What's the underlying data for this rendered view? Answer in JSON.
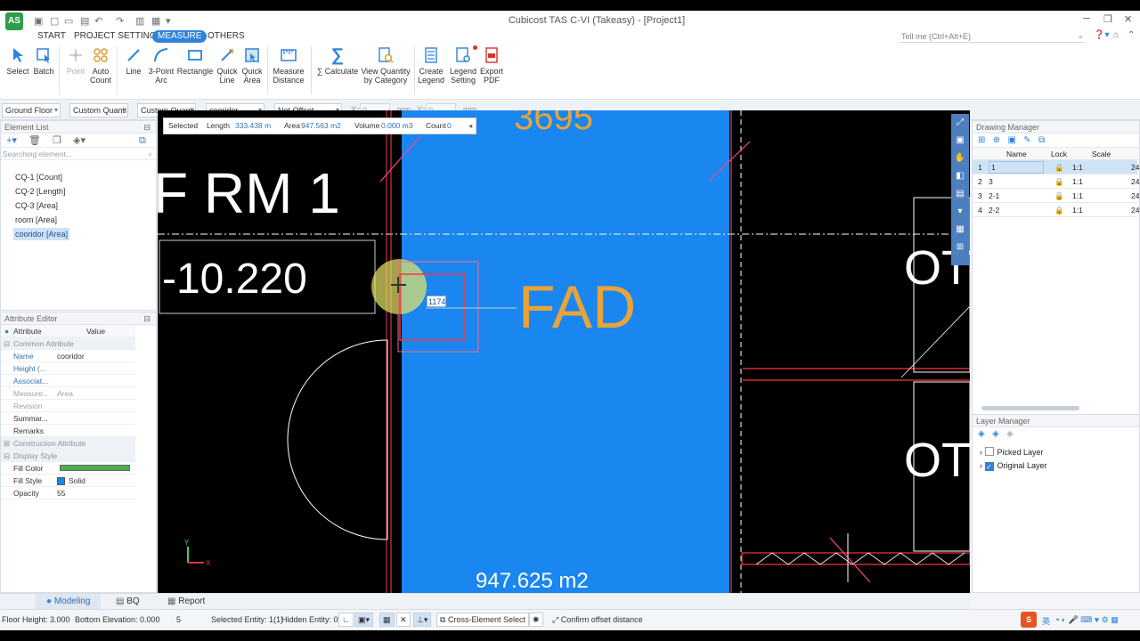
{
  "app": {
    "title": "Cubicost TAS C-VI (Takeasy) - [Project1]",
    "logo_text": "AS"
  },
  "tabs": [
    "START",
    "PROJECT SETTINGS",
    "MEASURE",
    "OTHERS"
  ],
  "active_tab": "MEASURE",
  "tell_me": "Tell me (Ctrl+Alt+E)",
  "ribbon": {
    "select": "Select",
    "batch": "Batch",
    "point": "Point",
    "auto_count_1": "Auto",
    "auto_count_2": "Count",
    "line": "Line",
    "arc_1": "3-Point",
    "arc_2": "Arc",
    "rectangle": "Rectangle",
    "quick_line_1": "Quick",
    "quick_line_2": "Line",
    "quick_area_1": "Quick",
    "quick_area_2": "Area",
    "measure_1": "Measure",
    "measure_2": "Distance",
    "calculate": "∑ Calculate",
    "viewq_1": "View Quantity",
    "viewq_2": "by Category",
    "create_legend_1": "Create",
    "create_legend_2": "Legend",
    "legend_setting_1": "Legend",
    "legend_setting_2": "Setting",
    "export_1": "Export",
    "export_2": "PDF"
  },
  "options": {
    "floor": "Ground Floor",
    "custom1": "Custom Quanti",
    "custom2": "Custom Quanti",
    "element": "cooridor",
    "offset": "Not Offset",
    "x_label": "X=",
    "x_value": "0",
    "y_label": "Y=",
    "y_value": "0",
    "unit": "mm"
  },
  "element_list": {
    "title": "Element List",
    "search_placeholder": "Searching element...",
    "items": [
      "CQ-1 [Count]",
      "CQ-2 [Length]",
      "CQ-3 [Area]",
      "room [Area]",
      "cooridor [Area]"
    ]
  },
  "attribute_editor": {
    "title": "Attribute Editor",
    "col_attribute": "Attribute",
    "col_value": "Value",
    "group_common": "Common Attribute",
    "name_key": "Name",
    "name_val": "cooridor",
    "height_key": "Height (...",
    "assoc_key": "Associat...",
    "measure_key": "Measure...",
    "measure_val": "Area",
    "revision_key": "Revision",
    "summary_key": "Summar...",
    "remarks_key": "Remarks",
    "group_construction": "Construction Attribute",
    "group_display": "Display Style",
    "fill_color_key": "Fill Color",
    "fill_color": "#4caf50",
    "fill_style_key": "Fill Style",
    "fill_style_val": "Solid",
    "opacity_key": "Opacity",
    "opacity_val": "55"
  },
  "info_bar": {
    "selected": "Selected",
    "length_label": "Length",
    "length_val": "333.438 m",
    "area_label": "Area",
    "area_val": "947.563 m2",
    "volume_label": "Volume",
    "volume_val": "0.000 m3",
    "count_label": "Count",
    "count_val": "0"
  },
  "canvas": {
    "top_number": "3695",
    "room_label": "F RM 1",
    "level_text": "-10.220",
    "fad_text": "FAD",
    "area_text": "947.625 m2",
    "right_text1": "OT",
    "right_text2": "OT",
    "input_val": "1174",
    "fill_color": "#1a86ef"
  },
  "drawing_manager": {
    "title": "Drawing Manager",
    "cols": [
      "Name",
      "Lock",
      "Scale"
    ],
    "rows": [
      {
        "idx": "1",
        "name": "1",
        "scale": "1:1",
        "extra": "24"
      },
      {
        "idx": "2",
        "name": "3",
        "scale": "1:1",
        "extra": "24"
      },
      {
        "idx": "3",
        "name": "2-1",
        "scale": "1:1",
        "extra": "24"
      },
      {
        "idx": "4",
        "name": "2-2",
        "scale": "1:1",
        "extra": "24"
      }
    ]
  },
  "layer_manager": {
    "title": "Layer Manager",
    "layers": [
      "Picked Layer",
      "Original Layer"
    ]
  },
  "bottom_tabs": [
    "Modeling",
    "BQ",
    "Report"
  ],
  "status": {
    "floor_height": "Floor Height: 3.000",
    "bottom_elevation": "Bottom Elevation: 0.000",
    "count": "5",
    "selected_entity": "Selected Entity: 1(1)",
    "hidden_entity": "Hidden Entity: 0",
    "cross_element": "Cross-Element Select",
    "confirm_offset": "Confirm offset distance",
    "ime_label": "英"
  }
}
